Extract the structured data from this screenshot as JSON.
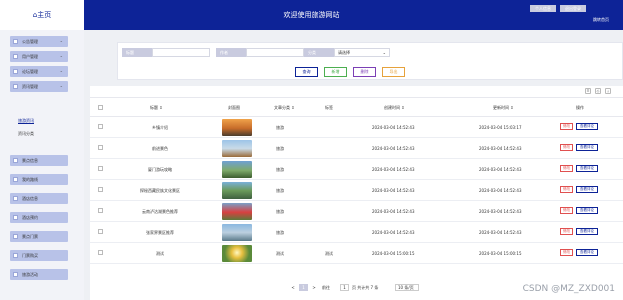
{
  "app": {
    "logo": "⌂主页",
    "title": "欢迎使用旅游网站"
  },
  "header": {
    "btn1": "个人信息",
    "btn2": "退出登录",
    "link": "跳转首页"
  },
  "sidebar": {
    "groups_top": [
      {
        "label": "公告管理"
      },
      {
        "label": "用户管理"
      },
      {
        "label": "论坛管理"
      },
      {
        "label": "资讯管理"
      }
    ],
    "sub_items": [
      {
        "label": "旅游资讯",
        "active": true
      },
      {
        "label": "资讯分类",
        "active": false
      }
    ],
    "groups_bottom": [
      {
        "label": "景点信息"
      },
      {
        "label": "我的路线"
      },
      {
        "label": "酒店信息"
      },
      {
        "label": "酒店预约"
      },
      {
        "label": "景点门票"
      },
      {
        "label": "门票购买"
      },
      {
        "label": "旅游活动"
      }
    ]
  },
  "search": {
    "title_label": "标题",
    "title_placeholder": "标题",
    "author_label": "作者",
    "author_placeholder": "作者",
    "category_label": "分类",
    "category_value": "请选择",
    "btn_query": "查询",
    "btn_add": "新增",
    "btn_delete": "删除",
    "btn_export": "导出"
  },
  "table": {
    "headers": [
      "标题",
      "封面图",
      "文章分类",
      "标签",
      "创建时间",
      "更新时间",
      "操作"
    ],
    "rows": [
      {
        "title": "乡镇介绍",
        "category": "旅游",
        "tag": "",
        "created": "2024-03-04 14:52:43",
        "updated": "2024-03-04 15:03:17",
        "thumb": "sunset"
      },
      {
        "title": "前进景色",
        "category": "旅游",
        "tag": "",
        "created": "2024-03-04 14:52:43",
        "updated": "2024-03-04 14:52:43",
        "thumb": "pagoda"
      },
      {
        "title": "厦门游玩攻略",
        "category": "旅游",
        "tag": "",
        "created": "2024-03-04 14:52:43",
        "updated": "2024-03-04 14:52:43",
        "thumb": "mountain"
      },
      {
        "title": "探秘西藏民族文化景区",
        "category": "旅游",
        "tag": "",
        "created": "2024-03-04 14:52:43",
        "updated": "2024-03-04 14:52:43",
        "thumb": "village"
      },
      {
        "title": "云南泸沽湖景色推荐",
        "category": "旅游",
        "tag": "",
        "created": "2024-03-04 14:52:43",
        "updated": "2024-03-04 14:52:43",
        "thumb": "flowers"
      },
      {
        "title": "张家界景区推荐",
        "category": "旅游",
        "tag": "",
        "created": "2024-03-04 14:52:43",
        "updated": "2024-03-04 14:52:43",
        "thumb": "cliff"
      },
      {
        "title": "测试",
        "category": "测试",
        "tag": "测试",
        "created": "2024-03-04 15:00:15",
        "updated": "2024-03-04 15:00:15",
        "thumb": "sun"
      }
    ],
    "row_actions": [
      "修改",
      "查看评论"
    ],
    "tools": [
      "filter",
      "print",
      "export"
    ]
  },
  "pager": {
    "prev": "<",
    "page": "1",
    "next": ">",
    "goto_label": "前往",
    "goto_value": "1",
    "suffix": "页 共计共 7 条",
    "page_size": "10 条/页"
  },
  "watermark": "CSDN @MZ_ZXD001",
  "colors": {
    "header": "#0d2397",
    "menu_group": "#b8c2e8",
    "query_border": "#0d2397",
    "add_border": "#4caf50",
    "delete_border": "#7b3fb5",
    "export_border": "#e6a23c"
  }
}
